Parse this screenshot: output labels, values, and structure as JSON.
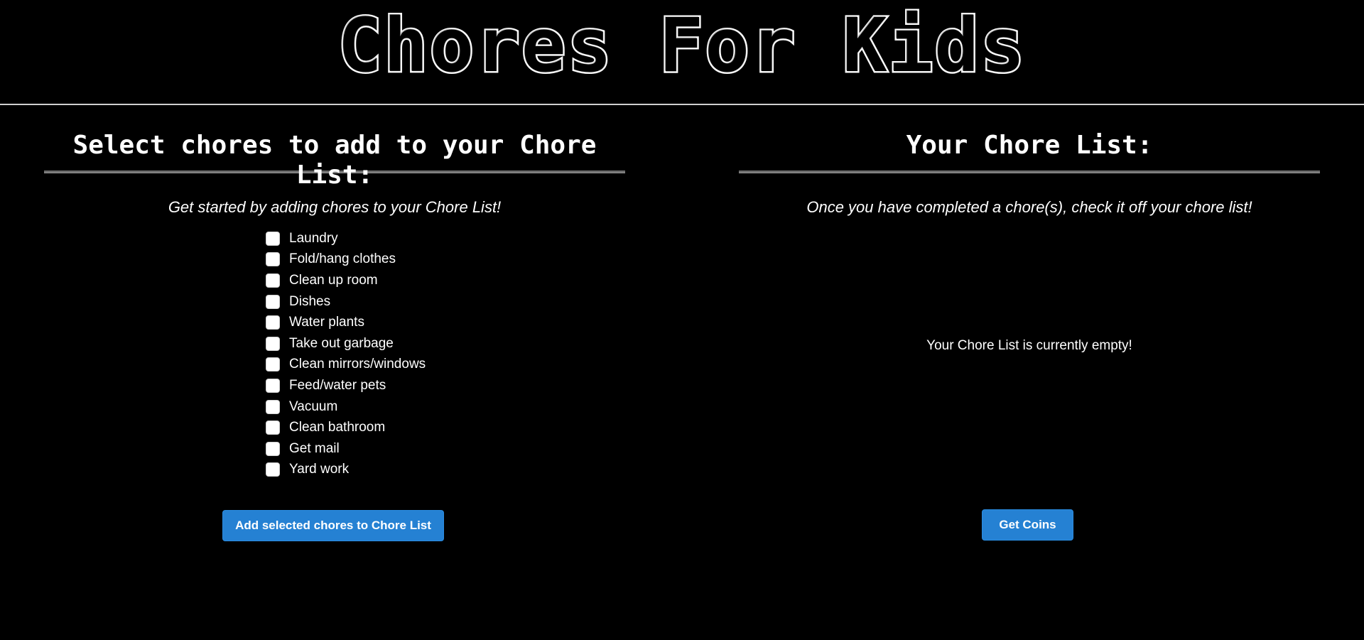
{
  "app": {
    "title": "Chores For Kids"
  },
  "left_panel": {
    "heading": "Select chores to add to your Chore List:",
    "subtitle": "Get started by adding chores to your Chore List!",
    "chores": [
      {
        "label": "Laundry",
        "checked": false
      },
      {
        "label": "Fold/hang clothes",
        "checked": false
      },
      {
        "label": "Clean up room",
        "checked": false
      },
      {
        "label": "Dishes",
        "checked": false
      },
      {
        "label": "Water plants",
        "checked": false
      },
      {
        "label": "Take out garbage",
        "checked": false
      },
      {
        "label": "Clean mirrors/windows",
        "checked": false
      },
      {
        "label": "Feed/water pets",
        "checked": false
      },
      {
        "label": "Vacuum",
        "checked": false
      },
      {
        "label": "Clean bathroom",
        "checked": false
      },
      {
        "label": "Get mail",
        "checked": false
      },
      {
        "label": "Yard work",
        "checked": false
      }
    ],
    "add_button_label": "Add selected chores to Chore List"
  },
  "right_panel": {
    "heading": "Your Chore List:",
    "subtitle": "Once you have completed a chore(s), check it off your chore list!",
    "empty_message": "Your Chore List is currently empty!",
    "coins_button_label": "Get Coins"
  },
  "colors": {
    "background": "#000000",
    "text": "#ffffff",
    "button": "#2581d3"
  }
}
